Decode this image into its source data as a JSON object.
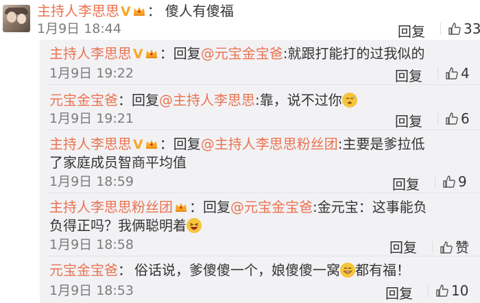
{
  "main": {
    "name": "主持人李思思",
    "colon": "：",
    "content": "傻人有傻福",
    "time": "1月9日 18:44",
    "reply_label": "回复",
    "likes": "33"
  },
  "replies": [
    {
      "name": "主持人李思思",
      "verified": true,
      "crown": true,
      "reply_word": "回复",
      "mention": "@元宝金宝爸",
      "text": ":就跟打能打的过我似的",
      "text2": "",
      "emoji": "",
      "after_emoji": "",
      "time": "1月9日 19:22",
      "reply_label": "回复",
      "likes": "4"
    },
    {
      "name": "元宝金宝爸",
      "verified": false,
      "crown": false,
      "reply_word": "回复",
      "mention": "@主持人李思思",
      "text": ":靠，说不过你",
      "text2": "",
      "emoji": "sweat-face-emoji",
      "after_emoji": "",
      "time": "1月9日 19:21",
      "reply_label": "回复",
      "likes": "6"
    },
    {
      "name": "主持人李思思",
      "verified": true,
      "crown": true,
      "reply_word": "回复",
      "mention": "@主持人李思思粉丝团",
      "text": ":主要是爹拉低",
      "text2": "了家庭成员智商平均值",
      "emoji": "",
      "after_emoji": "",
      "time": "1月9日 18:59",
      "reply_label": "回复",
      "likes": "9"
    },
    {
      "name": "主持人李思思粉丝团",
      "verified": false,
      "crown": true,
      "reply_word": "回复",
      "mention": "@元宝金宝爸",
      "text": ":金元宝：这事能负",
      "text2": "负得正吗？我俩聪明着",
      "emoji": "laughing-face-emoji",
      "after_emoji": "",
      "time": "1月9日 18:58",
      "reply_label": "回复",
      "likes": "赞"
    },
    {
      "name": "元宝金宝爸",
      "verified": false,
      "crown": false,
      "reply_word": "",
      "mention": "",
      "text": "俗话说，爹傻傻一个，娘傻傻一窝",
      "text2": "",
      "emoji": "grin-face-emoji",
      "after_emoji": "都有福！",
      "time": "1月9日 18:53",
      "reply_label": "回复",
      "likes": "10"
    }
  ],
  "colors": {
    "name": "#eb7350",
    "text": "#333333",
    "time": "#7b7b7b",
    "reply_bg": "#f2f2f5",
    "verified": "#f7a825"
  },
  "icons": {
    "verified": "v-badge-icon",
    "crown": "crown-member-icon",
    "like": "thumbs-up-icon"
  }
}
